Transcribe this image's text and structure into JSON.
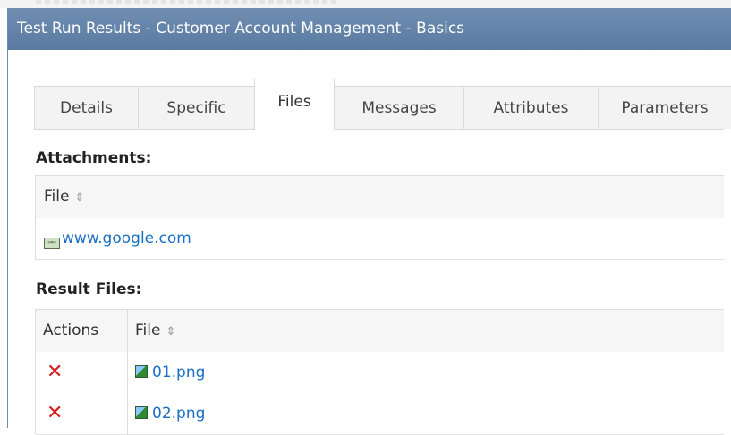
{
  "window": {
    "title": "Test Run Results - Customer Account Management - Basics"
  },
  "tabs": [
    {
      "label": "Details",
      "active": false
    },
    {
      "label": "Specific",
      "active": false
    },
    {
      "label": "Files",
      "active": true
    },
    {
      "label": "Messages",
      "active": false
    },
    {
      "label": "Attributes",
      "active": false
    },
    {
      "label": "Parameters",
      "active": false
    }
  ],
  "attachments": {
    "heading": "Attachments:",
    "column_file": "File",
    "sort_glyph": "⇕",
    "items": [
      {
        "icon": "web-link-icon",
        "name": "www.google.com"
      }
    ]
  },
  "result_files": {
    "heading": "Result Files:",
    "column_actions": "Actions",
    "column_file": "File",
    "sort_glyph": "⇕",
    "delete_glyph": "✕",
    "items": [
      {
        "icon": "image-file-icon",
        "name": "01.png"
      },
      {
        "icon": "image-file-icon",
        "name": "02.png"
      }
    ]
  },
  "colors": {
    "titlebar": "#6384aa",
    "link": "#1a6fc2",
    "delete": "#d32020"
  }
}
